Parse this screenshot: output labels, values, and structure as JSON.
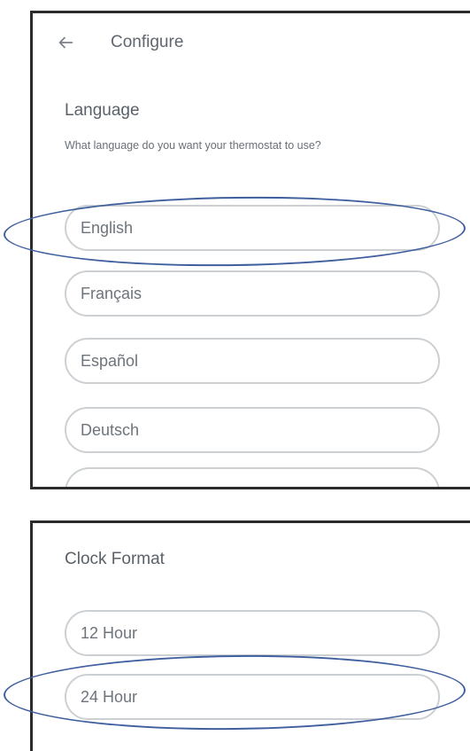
{
  "language_screen": {
    "back_icon": "back-arrow-icon",
    "header_title": "Configure",
    "section_title": "Language",
    "section_subtitle": "What language do you want your thermostat to use?",
    "options": [
      "English",
      "Français",
      "Español",
      "Deutsch"
    ],
    "highlighted_option": "English"
  },
  "clock_screen": {
    "section_title": "Clock Format",
    "options": [
      "12 Hour",
      "24 Hour"
    ],
    "highlighted_option": "24 Hour"
  },
  "colors": {
    "annotation_outline": "#3f5f9f",
    "option_border": "#cdd0d3",
    "panel_frame": "#2b2b2b"
  }
}
